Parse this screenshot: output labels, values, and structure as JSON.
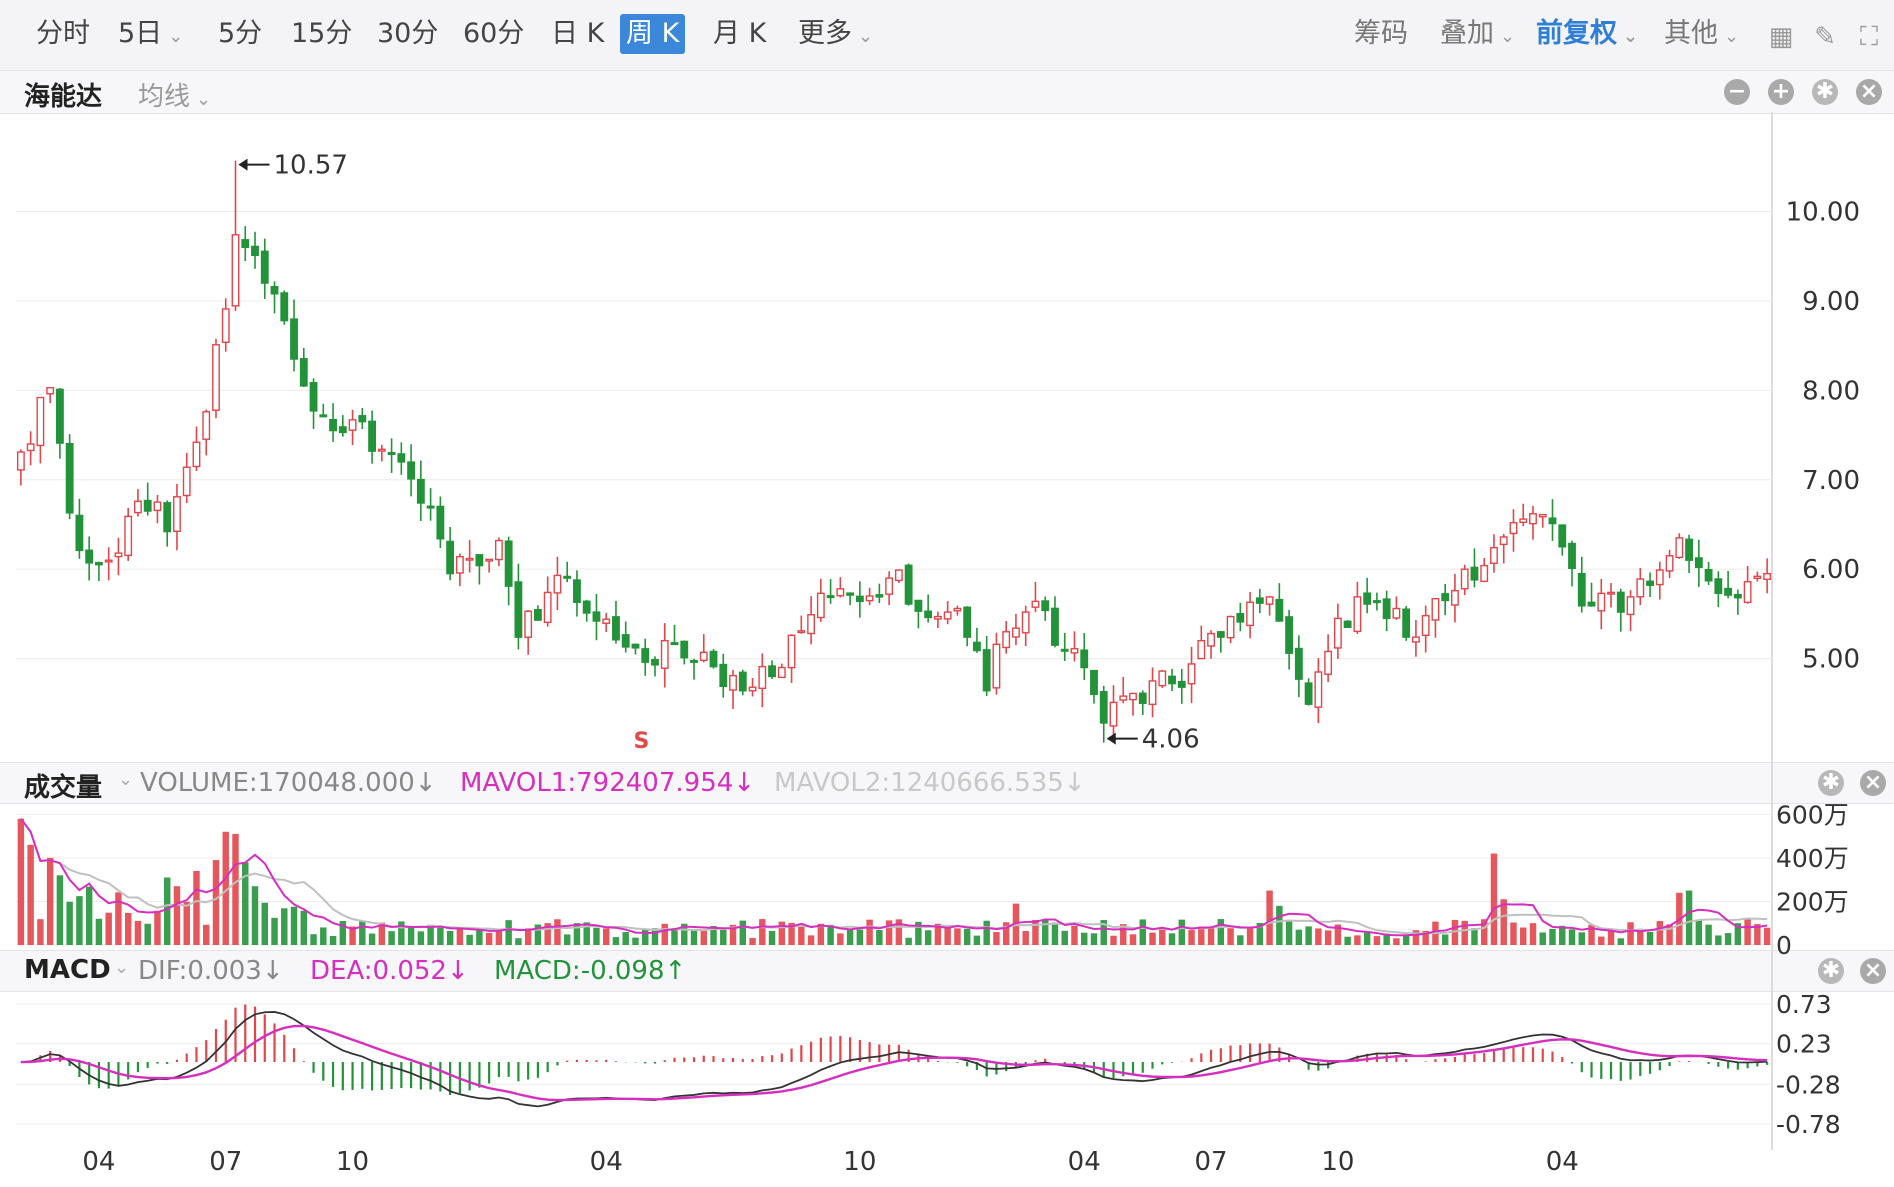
{
  "toolbar": {
    "tabs": [
      "分时",
      "5日",
      "5分",
      "15分",
      "30分",
      "60分",
      "日 K",
      "周 K",
      "月 K",
      "更多"
    ],
    "active_tab": "周 K",
    "right_items": [
      "筹码",
      "叠加",
      "前复权",
      "其他"
    ]
  },
  "stock": {
    "name": "海能达",
    "ma_label": "均线"
  },
  "volume_bar": {
    "title": "成交量",
    "volume": "VOLUME:170048.000↓",
    "mavol1": "MAVOL1:792407.954↓",
    "mavol2": "MAVOL2:1240666.535↓"
  },
  "macd_bar": {
    "title": "MACD",
    "dif": "DIF:0.003↓",
    "dea": "DEA:0.052↓",
    "macd": "MACD:-0.098↑"
  },
  "colors": {
    "up": "#e2454a",
    "down": "#23933a",
    "ma1": "#d62fbf",
    "ma2": "#c0c0c0"
  },
  "chart_data": [
    {
      "type": "candlestick",
      "title": "海能达 周K",
      "y_ticks": [
        "10.00",
        "9.00",
        "8.00",
        "7.00",
        "6.00",
        "5.00"
      ],
      "ylim": [
        4.0,
        10.8
      ],
      "annotations": [
        {
          "text": "10.57",
          "week": 22,
          "value": 10.57
        },
        {
          "text": "4.06",
          "week": 111,
          "value": 4.06
        }
      ],
      "marker_text": "S",
      "x_ticks": [
        {
          "label": "04",
          "week": 8
        },
        {
          "label": "07",
          "week": 21
        },
        {
          "label": "10",
          "week": 34
        },
        {
          "label": "04",
          "week": 60
        },
        {
          "label": "10",
          "week": 86
        },
        {
          "label": "04",
          "week": 109
        },
        {
          "label": "07",
          "week": 122
        },
        {
          "label": "10",
          "week": 135
        },
        {
          "label": "04",
          "week": 158
        }
      ],
      "anchors": [
        [
          0,
          7.3
        ],
        [
          3,
          8.0
        ],
        [
          5,
          6.5
        ],
        [
          8,
          6.0
        ],
        [
          13,
          6.8
        ],
        [
          15,
          6.4
        ],
        [
          18,
          7.3
        ],
        [
          21,
          9.0
        ],
        [
          22,
          9.6
        ],
        [
          24,
          9.4
        ],
        [
          27,
          8.8
        ],
        [
          30,
          7.7
        ],
        [
          35,
          7.5
        ],
        [
          40,
          7.0
        ],
        [
          44,
          6.1
        ],
        [
          49,
          6.2
        ],
        [
          51,
          5.2
        ],
        [
          55,
          5.9
        ],
        [
          58,
          5.6
        ],
        [
          63,
          5.05
        ],
        [
          68,
          5.1
        ],
        [
          74,
          4.6
        ],
        [
          78,
          5.0
        ],
        [
          82,
          5.7
        ],
        [
          87,
          5.7
        ],
        [
          90,
          6.0
        ],
        [
          92,
          5.5
        ],
        [
          96,
          5.5
        ],
        [
          99,
          4.8
        ],
        [
          101,
          5.3
        ],
        [
          104,
          5.5
        ],
        [
          107,
          5.2
        ],
        [
          111,
          4.4
        ],
        [
          115,
          4.6
        ],
        [
          119,
          4.8
        ],
        [
          122,
          5.3
        ],
        [
          126,
          5.6
        ],
        [
          129,
          5.5
        ],
        [
          132,
          4.6
        ],
        [
          135,
          5.4
        ],
        [
          139,
          5.7
        ],
        [
          142,
          5.3
        ],
        [
          146,
          5.6
        ],
        [
          150,
          6.1
        ],
        [
          154,
          6.6
        ],
        [
          157,
          6.5
        ],
        [
          160,
          5.7
        ],
        [
          164,
          5.6
        ],
        [
          167,
          5.8
        ],
        [
          170,
          6.3
        ],
        [
          173,
          5.9
        ],
        [
          175,
          5.7
        ],
        [
          178,
          5.8
        ]
      ]
    },
    {
      "type": "bar",
      "title": "成交量",
      "y_ticks": [
        "600万",
        "400万",
        "200万",
        "0"
      ],
      "ylim": [
        0,
        6200000
      ],
      "spikes": [
        {
          "week": 0,
          "value": 5800000
        },
        {
          "week": 1,
          "value": 4600000
        },
        {
          "week": 3,
          "value": 4000000
        },
        {
          "week": 4,
          "value": 3200000
        },
        {
          "week": 15,
          "value": 3100000
        },
        {
          "week": 16,
          "value": 2700000
        },
        {
          "week": 18,
          "value": 3400000
        },
        {
          "week": 20,
          "value": 3900000
        },
        {
          "week": 21,
          "value": 5200000
        },
        {
          "week": 22,
          "value": 5100000
        },
        {
          "week": 23,
          "value": 3800000
        },
        {
          "week": 24,
          "value": 2700000
        },
        {
          "week": 102,
          "value": 1900000
        },
        {
          "week": 128,
          "value": 2500000
        },
        {
          "week": 129,
          "value": 1800000
        },
        {
          "week": 151,
          "value": 4200000
        },
        {
          "week": 152,
          "value": 2100000
        },
        {
          "week": 170,
          "value": 2400000
        },
        {
          "week": 171,
          "value": 2500000
        }
      ]
    },
    {
      "type": "histogram",
      "title": "MACD",
      "y_ticks": [
        "0.73",
        "0.23",
        "-0.28",
        "-0.78"
      ],
      "ylim": [
        -0.78,
        0.73
      ]
    }
  ]
}
